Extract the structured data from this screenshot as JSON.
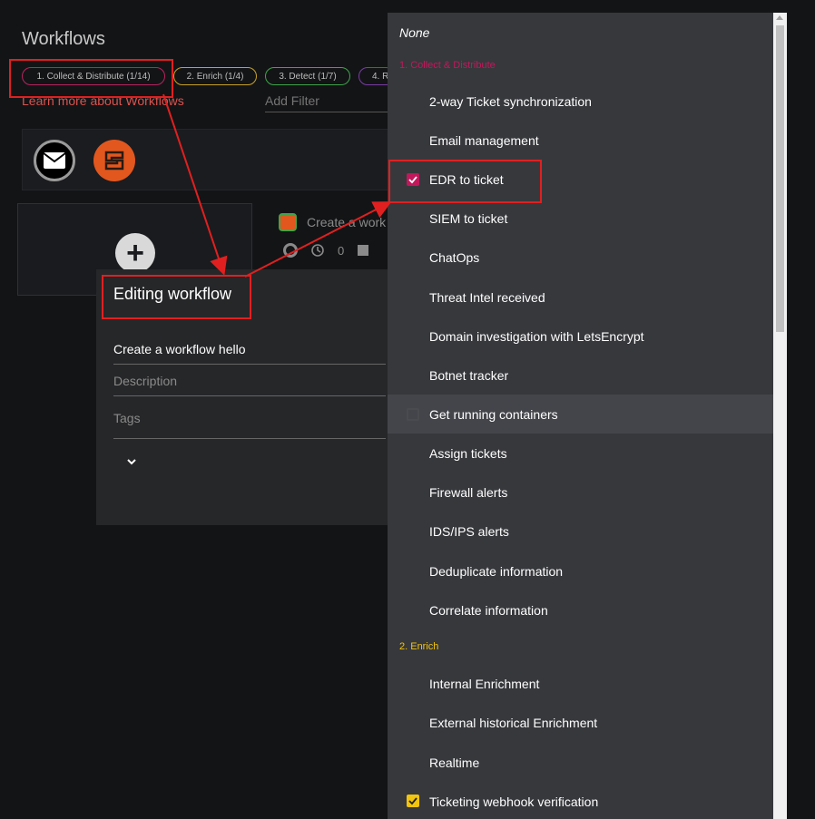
{
  "page": {
    "title": "Workflows",
    "learn_more": "Learn more about Workflows",
    "add_filter_placeholder": "Add Filter"
  },
  "chips": [
    {
      "label": "1. Collect & Distribute (1/14)"
    },
    {
      "label": "2. Enrich (1/4)"
    },
    {
      "label": "3. Detect (1/7)"
    },
    {
      "label": "4. R"
    }
  ],
  "workflow_card": {
    "title": "Create a work",
    "runs": "0"
  },
  "modal": {
    "title": "Editing workflow",
    "name_value": "Create a workflow hello",
    "description_placeholder": "Description",
    "tags_placeholder": "Tags"
  },
  "dropdown": {
    "none_label": "None",
    "groups": [
      {
        "label": "1. Collect & Distribute",
        "color": "#c2185b",
        "items": [
          {
            "label": "2-way Ticket synchronization"
          },
          {
            "label": "Email management"
          },
          {
            "label": "EDR to ticket",
            "checked": true
          },
          {
            "label": "SIEM to ticket"
          },
          {
            "label": "ChatOps"
          },
          {
            "label": "Threat Intel received"
          },
          {
            "label": "Domain investigation with LetsEncrypt"
          },
          {
            "label": "Botnet tracker"
          },
          {
            "label": "Get running containers",
            "checked": false
          },
          {
            "label": "Assign tickets"
          },
          {
            "label": "Firewall alerts"
          },
          {
            "label": "IDS/IPS alerts"
          },
          {
            "label": "Deduplicate information"
          },
          {
            "label": "Correlate information"
          }
        ]
      },
      {
        "label": "2. Enrich",
        "color": "#f1c40f",
        "items": [
          {
            "label": "Internal Enrichment"
          },
          {
            "label": "External historical Enrichment"
          },
          {
            "label": "Realtime"
          },
          {
            "label": "Ticketing webhook verification",
            "checked": true
          }
        ]
      }
    ]
  }
}
